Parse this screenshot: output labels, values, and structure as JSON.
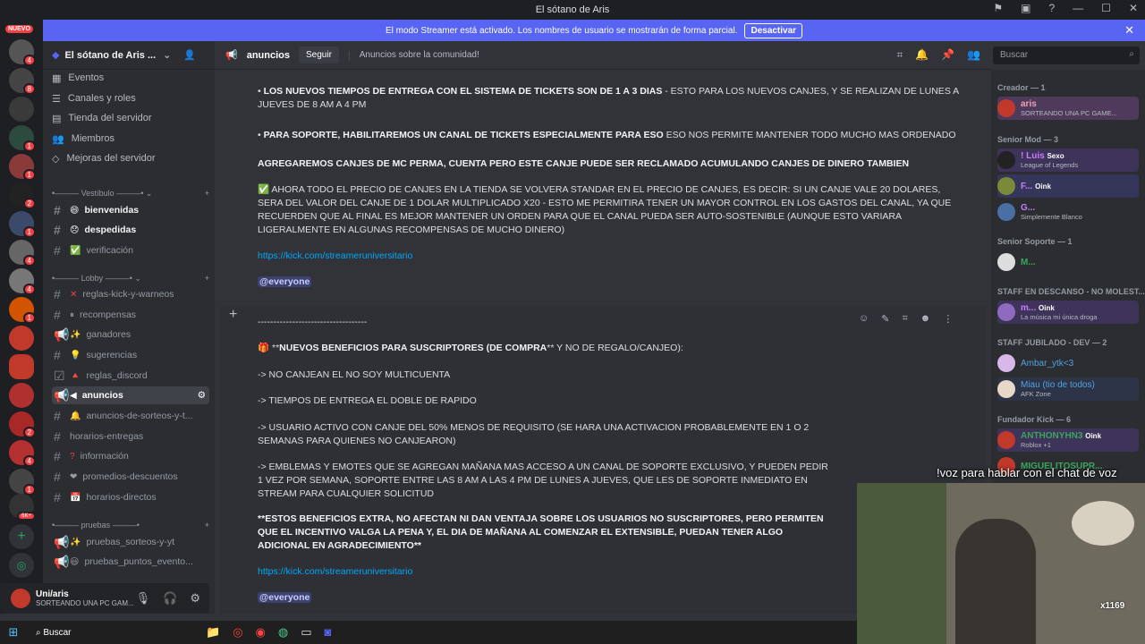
{
  "window": {
    "title": "El sótano de Aris"
  },
  "banner": {
    "text": "El modo Streamer está activado. Los nombres de usuario se mostrarán de forma parcial.",
    "button": "Desactivar"
  },
  "rail": {
    "new_label": "NUEVO",
    "badges": [
      "4",
      "8",
      "1",
      "1",
      "2",
      "1",
      "4",
      "4",
      "1",
      "2",
      "4",
      "1",
      "2"
    ],
    "pw_badge": "6K+"
  },
  "server": {
    "name": "El sótano de Aris ..."
  },
  "nav": [
    "Eventos",
    "Canales y roles",
    "Tienda del servidor",
    "Miembros",
    "Mejoras del servidor"
  ],
  "categories": {
    "vestibulo": "Vestíbulo",
    "lobby": "Lobby",
    "pruebas": "pruebas"
  },
  "channels": {
    "bienvenidas": "bienvenidas",
    "despedidas": "despedidas",
    "verificacion": "verificación",
    "reglas_kick": "reglas-kick-y-warneos",
    "recompensas": "recompensas",
    "ganadores": "ganadores",
    "sugerencias": "sugerencias",
    "reglas_discord": "reglas_discord",
    "anuncios": "anuncios",
    "anuncios_sorteos": "anuncios-de-sorteos-y-t...",
    "horarios_entregas": "horarios-entregas",
    "informacion": "información",
    "promedios": "promedios-descuentos",
    "horarios_directos": "horarios-directos",
    "pruebas_sorteos": "pruebas_sorteos-y-yt",
    "pruebas_puntos": "pruebas_puntos_evento..."
  },
  "user": {
    "name": "Uni/aris",
    "status": "SORTEANDO UNA PC GAM..."
  },
  "header": {
    "channel": "anuncios",
    "follow": "Seguir",
    "topic": "Anuncios sobre la comunidad!"
  },
  "search": {
    "placeholder": "Buscar"
  },
  "messages": {
    "m1_bold": "LOS NUEVOS TIEMPOS DE ENTREGA CON EL SISTEMA DE TICKETS SON DE 1 A 3 DIAS",
    "m1_rest": " - ESTO PARA LOS NUEVOS CANJES, Y SE REALIZAN DE LUNES A JUEVES DE 8 AM A 4 PM",
    "m2_bold": "PARA SOPORTE, HABILITAREMOS UN CANAL DE TICKETS ESPECIALMENTE PARA ESO",
    "m2_rest": " ESO NOS PERMITE MANTENER TODO MUCHO MAS ORDENADO",
    "m3": "AGREGAREMOS CANJES DE MC PERMA, CUENTA PERO ESTE CANJE PUEDE SER RECLAMADO ACUMULANDO CANJES DE DINERO TAMBIEN",
    "m4": "AHORA TODO EL PRECIO DE CANJES EN LA TIENDA SE VOLVERA STANDAR EN EL PRECIO DE CANJES, ES DECIR: SI UN CANJE VALE 20 DOLARES, SERA DEL VALOR DEL CANJE DE 1 DOLAR MULTIPLICADO X20 - ESTO ME PERMITIRA TENER UN MAYOR CONTROL EN LOS GASTOS DEL CANAL, YA QUE RECUERDEN QUE AL FINAL ES MEJOR MANTENER UN ORDEN PARA QUE EL CANAL PUEDA SER AUTO-SOSTENIBLE (AUNQUE ESTO VARIARA LIGERALMENTE EN ALGUNAS RECOMPENSAS DE MUCHO DINERO)",
    "link1": "https://kick.com/streameruniversitario",
    "mention1": "@everyone",
    "divider": "-----------------------------------",
    "b_title": "NUEVOS BENEFICIOS PARA SUSCRIPTORES (DE COMPRA",
    "b_title_rest": "** Y NO DE REGALO/CANJEO):",
    "b1": "-> NO CANJEAN EL NO SOY MULTICUENTA",
    "b2": "-> TIEMPOS DE ENTREGA EL DOBLE DE RAPIDO",
    "b3": "-> USUARIO ACTIVO CON CANJE DEL 50% MENOS DE REQUISITO (SE HARA UNA ACTIVACION PROBABLEMENTE EN 1 O 2 SEMANAS PARA QUIENES NO CANJEARON)",
    "b4": "-> EMBLEMAS Y EMOTES QUE SE AGREGAN MAÑANA MAS ACCESO A UN CANAL DE SOPORTE EXCLUSIVO, Y PUEDEN PEDIR 1 VEZ POR SEMANA, SOPORTE ENTRE LAS 8 AM A LAS 4 PM DE LUNES A JUEVES, QUE LES DE SOPORTE INMEDIATO EN STREAM PARA CUALQUIER SOLICITUD",
    "b5": "ESTOS BENEFICIOS EXTRA, NO AFECTAN NI DAN VENTAJA SOBRE LOS USUARIOS NO SUSCRIPTORES, PERO PERMITEN QUE EL INCENTIVO VALGA LA PENA Y, EL DIA DE MAÑANA AL COMENZAR EL EXTENSIBLE, PUEDAN TENER ALGO ADICIONAL EN AGRADECIMIENTO",
    "link2": "https://kick.com/streameruniversitario",
    "mention2": "@everyone"
  },
  "members": {
    "groups": [
      {
        "title": "Creador — 1"
      },
      {
        "title": "Senior Mod — 3"
      },
      {
        "title": "Senior Soporte — 1"
      },
      {
        "title": "STAFF EN DESCANSO - NO MOLEST..."
      },
      {
        "title": "STAFF JUBILADO - DEV — 2"
      },
      {
        "title": "Fundador Kick — 6"
      }
    ],
    "list": [
      {
        "name": "aris",
        "status": "SORTEANDO UNA PC GAME...",
        "color": "#f2a0b8"
      },
      {
        "name": "! Luis",
        "tag": "Sexo",
        "status": "League of Legends",
        "color": "#c77dff"
      },
      {
        "name": "F...",
        "tag": "Oink",
        "status": "",
        "color": "#c77dff"
      },
      {
        "name": "G...",
        "status": "Simplemente Blanco",
        "color": "#c77dff"
      },
      {
        "name": "M...",
        "status": "",
        "color": "#3ba55c"
      },
      {
        "name": "m...",
        "tag": "Oink",
        "status": "La música mi única droga",
        "color": "#c77dff"
      },
      {
        "name": "Ambar_ytk<3",
        "status": "",
        "color": "#4fa3e0"
      },
      {
        "name": "Miau (tio de todos)",
        "status": "AFK Zone",
        "color": "#4fa3e0"
      },
      {
        "name": "ANTHONYHN3",
        "tag": "Oink",
        "status": "Roblox +1",
        "color": "#3ba55c"
      },
      {
        "name": "MIGUELITOSUPR...",
        "status": "",
        "color": "#3ba55c"
      }
    ]
  },
  "overlay": {
    "subtitle": "!voz para hablar con el chat de voz",
    "cam_tag": "x1169"
  },
  "taskbar": {
    "search": "Buscar"
  }
}
